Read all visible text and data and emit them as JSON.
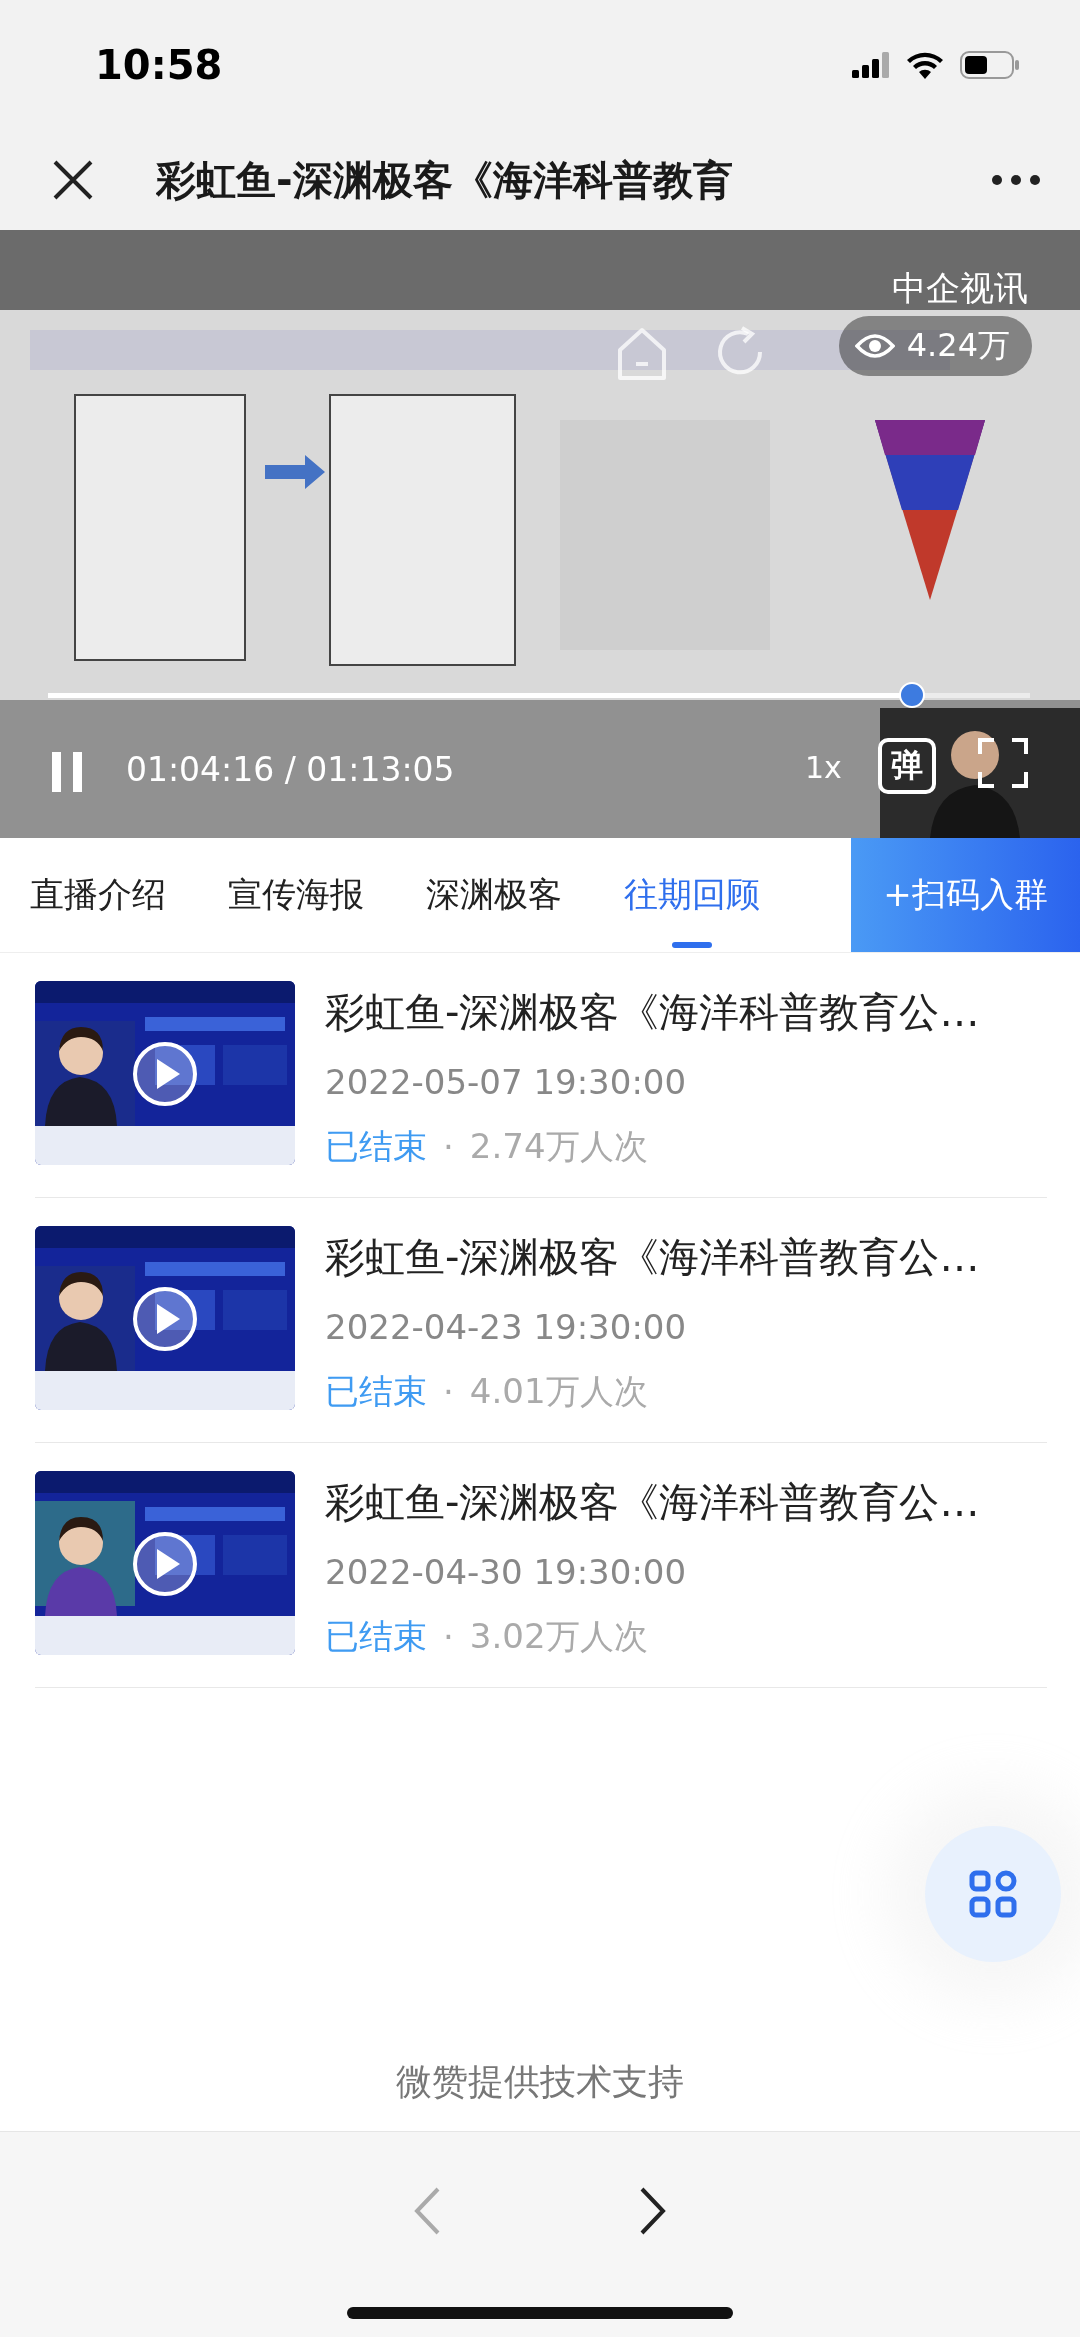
{
  "status_bar": {
    "time": "10:58"
  },
  "nav_bar": {
    "title": "彩虹鱼-深渊极客《海洋科普教育"
  },
  "player": {
    "kind": "picture",
    "channel": "中企视讯",
    "views": "4.24万",
    "level": 0.88,
    "playing": true,
    "time": "01:04:16 / 01:13:05",
    "speed": "1x",
    "danmaku_button": "弹"
  },
  "tabs": [
    {
      "label": "直播介绍",
      "selected": false
    },
    {
      "label": "宣传海报",
      "selected": false
    },
    {
      "label": "深渊极客",
      "selected": false
    },
    {
      "label": "往期回顾",
      "selected": true
    }
  ],
  "join_button": "+扫码入群",
  "replays": [
    {
      "kind": "picture",
      "title": "彩虹鱼-深渊极客《海洋科普教育公…",
      "date": "2022-05-07 19:30:00",
      "status": "已结束",
      "separator": "·",
      "views": "2.74万人次"
    },
    {
      "kind": "picture",
      "title": "彩虹鱼-深渊极客《海洋科普教育公…",
      "date": "2022-04-23 19:30:00",
      "status": "已结束",
      "separator": "·",
      "views": "4.01万人次"
    },
    {
      "kind": "picture",
      "title": "彩虹鱼-深渊极客《海洋科普教育公…",
      "date": "2022-04-30 19:30:00",
      "status": "已结束",
      "separator": "·",
      "views": "3.02万人次"
    }
  ],
  "footer": "微赞提供技术支持"
}
